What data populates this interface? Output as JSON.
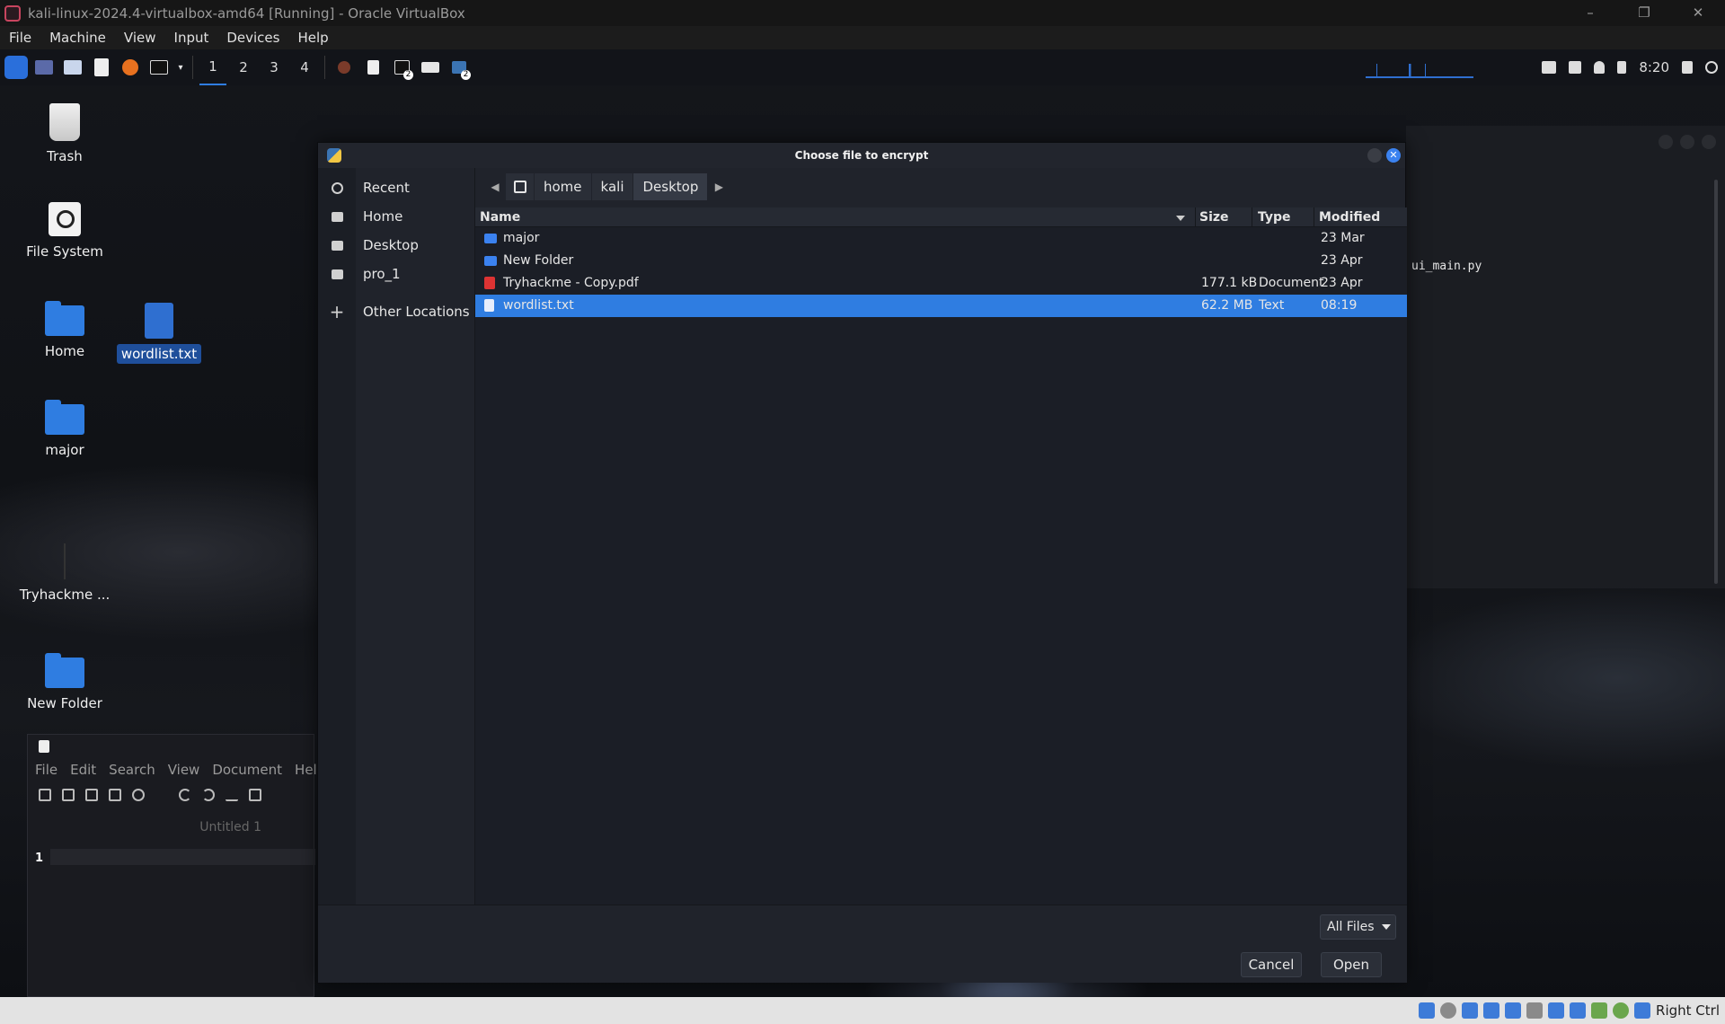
{
  "host": {
    "title": "kali-linux-2024.4-virtualbox-amd64 [Running] - Oracle VirtualBox",
    "window_controls": {
      "minimize": "–",
      "restore": "❐",
      "close": "✕"
    },
    "menu": [
      "File",
      "Machine",
      "View",
      "Input",
      "Devices",
      "Help"
    ],
    "status_right": "Right Ctrl"
  },
  "panel": {
    "workspaces": [
      "1",
      "2",
      "3",
      "4"
    ],
    "active_workspace": "1",
    "badge_a": "2",
    "badge_b": "2",
    "clock": "8:20"
  },
  "desktop": {
    "icons": [
      {
        "label": "Trash",
        "icon": "trash-icon"
      },
      {
        "label": "File System",
        "icon": "drive-icon"
      },
      {
        "label": "Home",
        "icon": "home-folder-icon"
      },
      {
        "label": "wordlist.txt",
        "icon": "text-file-icon"
      },
      {
        "label": "major",
        "icon": "folder-icon"
      },
      {
        "label": "Tryhackme ...",
        "icon": "pdf-file-icon"
      },
      {
        "label": "New Folder",
        "icon": "folder-icon"
      }
    ]
  },
  "editor": {
    "menu": [
      "File",
      "Edit",
      "Search",
      "View",
      "Document",
      "Help"
    ],
    "tab": "Untitled 1",
    "line_number": "1"
  },
  "terminal": {
    "text": "ui_main.py"
  },
  "dialog": {
    "title": "Choose file to encrypt",
    "close_glyph": "✕",
    "places": [
      "Recent",
      "Home",
      "Desktop",
      "pro_1",
      "Other Locations"
    ],
    "path": [
      "home",
      "kali",
      "Desktop"
    ],
    "columns": {
      "name": "Name",
      "size": "Size",
      "type": "Type",
      "modified": "Modified"
    },
    "files": [
      {
        "name": "major",
        "size": "",
        "type": "",
        "modified": "23 Mar",
        "kind": "folder"
      },
      {
        "name": "New Folder",
        "size": "",
        "type": "",
        "modified": "23 Apr",
        "kind": "folder"
      },
      {
        "name": "Tryhackme - Copy.pdf",
        "size": "177.1 kB",
        "type": "Document",
        "modified": "23 Apr",
        "kind": "pdf"
      },
      {
        "name": "wordlist.txt",
        "size": "62.2 MB",
        "type": "Text",
        "modified": "08:19",
        "kind": "txt",
        "selected": true
      }
    ],
    "filter": "All Files",
    "cancel": "Cancel",
    "open": "Open"
  },
  "colors": {
    "accent": "#2f7de1",
    "dialog_bg": "#20232b",
    "list_bg": "#1b1e26"
  }
}
